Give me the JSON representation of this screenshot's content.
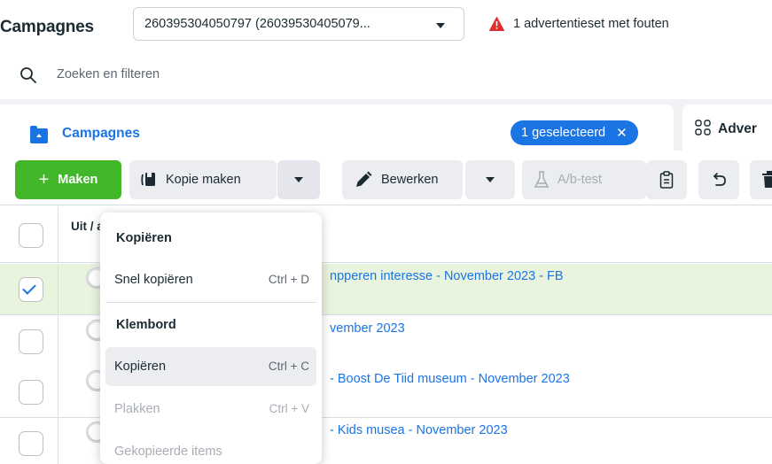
{
  "header": {
    "title": "Campagnes",
    "account_value": "260395304050797 (26039530405079...",
    "warning_text": "1 advertentieset met fouten"
  },
  "search": {
    "placeholder": "Zoeken en filteren"
  },
  "tabs": {
    "campaigns_label": "Campagnes",
    "selected_pill": "1 geselecteerd",
    "ads_label": "Adver"
  },
  "toolbar": {
    "make_label": "Maken",
    "copy_label": "Kopie maken",
    "edit_label": "Bewerken",
    "ab_test_label": "A/b-test"
  },
  "table": {
    "toggle_header": "Uit / aan",
    "rows": [
      {
        "name": "npperen interesse - November 2023 - FB",
        "selected": true
      },
      {
        "name": "vember 2023",
        "selected": false
      },
      {
        "name": "- Boost De Tiid museum - November 2023",
        "selected": false
      },
      {
        "name": "- Kids musea - November 2023",
        "selected": false
      }
    ]
  },
  "menu": {
    "section_copy": "Kopiëren",
    "quick_copy_label": "Snel kopiëren",
    "quick_copy_shortcut": "Ctrl + D",
    "section_clipboard": "Klembord",
    "copy_label": "Kopiëren",
    "copy_shortcut": "Ctrl + C",
    "paste_label": "Plakken",
    "paste_shortcut": "Ctrl + V",
    "copied_items_label": "Gekopieerde items"
  },
  "colors": {
    "accent_blue": "#1b74e4",
    "make_green": "#42b72a",
    "warning_red": "#e02e2e",
    "selected_row": "#e8f4de"
  },
  "icons": [
    "search-icon",
    "warning-icon",
    "folder-icon",
    "close-icon",
    "grid-icon",
    "plus-icon",
    "copy-icon",
    "pencil-icon",
    "flask-icon",
    "clipboard-icon",
    "undo-icon",
    "trash-icon",
    "chevron-down-icon",
    "check-icon"
  ]
}
